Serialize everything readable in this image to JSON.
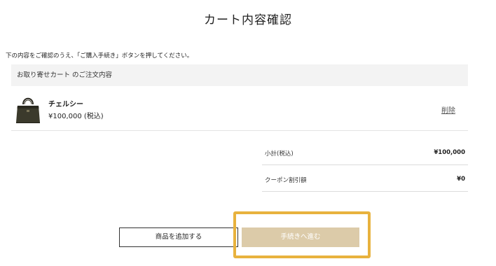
{
  "page": {
    "title": "カート内容確認",
    "instruction": "下の内容をご確認のうえ、「ご購入手続き」ボタンを押してください。"
  },
  "section": {
    "header": "お取り寄せカート のご注文内容"
  },
  "cart": {
    "items": [
      {
        "name": "チェルシー",
        "price": "¥100,000 (税込)",
        "delete_label": "削除",
        "image_icon": "handbag-icon"
      }
    ]
  },
  "summary": {
    "subtotal_label": "小計(税込)",
    "subtotal_value": "¥100,000",
    "coupon_label": "クーポン割引額",
    "coupon_value": "¥0"
  },
  "buttons": {
    "add_products": "商品を追加する",
    "proceed": "手続きへ進む"
  },
  "colors": {
    "proceed_button": "#dccba9",
    "highlight": "#e8b23e",
    "section_header_bg": "#f3f3f3"
  }
}
